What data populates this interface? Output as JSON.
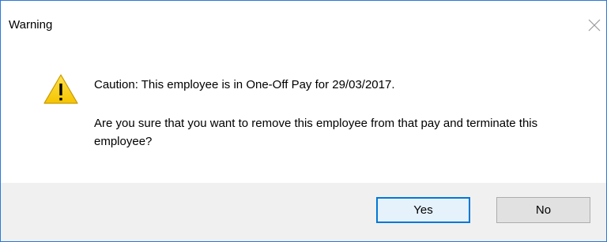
{
  "dialog": {
    "title": "Warning",
    "close_icon": "close-icon",
    "icon": "warning-triangle-icon",
    "message_line1": "Caution: This employee is in One-Off Pay for 29/03/2017.",
    "message_line2": "Are you sure that you want to remove this employee from that pay and terminate this employee?",
    "buttons": {
      "yes_label": "Yes",
      "no_label": "No"
    },
    "colors": {
      "border": "#2b79d7",
      "footer_bg": "#f0f0f0",
      "default_button_border": "#0078d7",
      "warning_fill": "#fcd116"
    }
  }
}
